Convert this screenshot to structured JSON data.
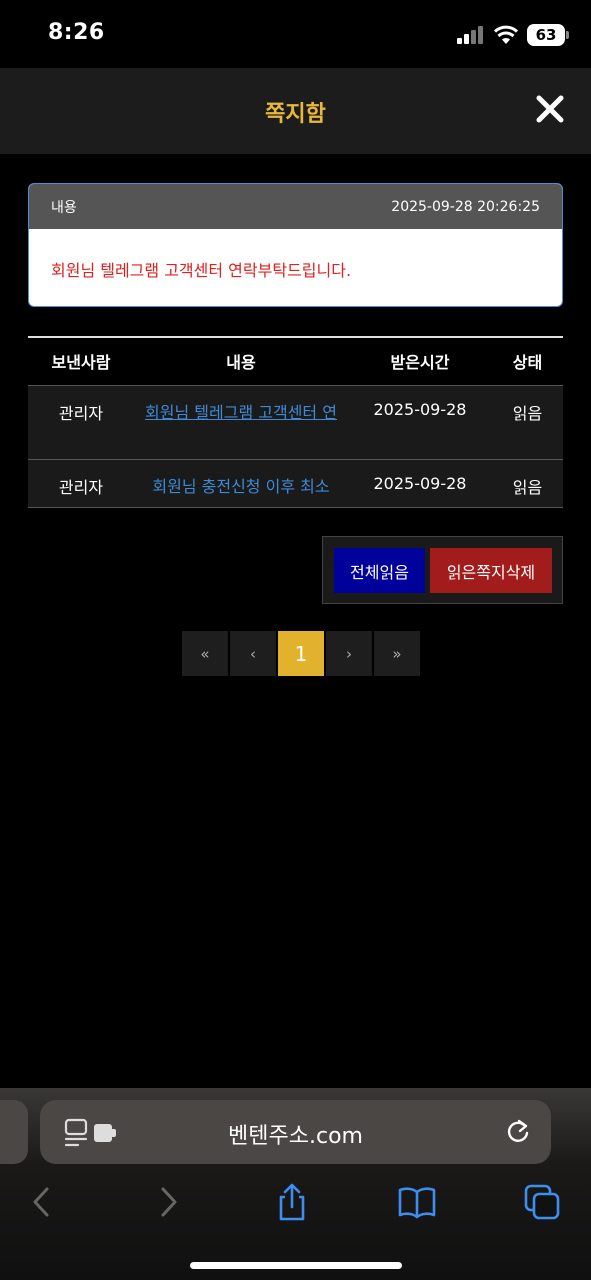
{
  "status_bar": {
    "time": "8:26",
    "battery": "63"
  },
  "header": {
    "title": "쪽지함"
  },
  "message": {
    "label": "내용",
    "datetime": "2025-09-28 20:26:25",
    "body": "회원님 텔레그램 고객센터 연락부탁드립니다."
  },
  "table": {
    "headers": [
      "보낸사람",
      "내용",
      "받은시간",
      "상태"
    ],
    "rows": [
      {
        "sender": "관리자",
        "content": "회원님 텔레그램 고객센터 연",
        "date": "2025-09-28",
        "status": "읽음"
      },
      {
        "sender": "관리자",
        "content": "회원님 충전신청 이후 최소",
        "date": "2025-09-28",
        "status": "읽음"
      }
    ]
  },
  "actions": {
    "read_all": "전체읽음",
    "delete_read": "읽은쪽지삭제"
  },
  "pagination": {
    "first": "«",
    "prev": "‹",
    "current": "1",
    "next": "›",
    "last": "»"
  },
  "browser": {
    "url": "벤텐주소.com"
  },
  "colors": {
    "title_accent": "#e8b83a",
    "alert_text": "#e0201e",
    "link": "#3d8ad6",
    "read_all_btn": "#00009a",
    "delete_btn": "#a21c1c",
    "active_page": "#e3b22d"
  }
}
